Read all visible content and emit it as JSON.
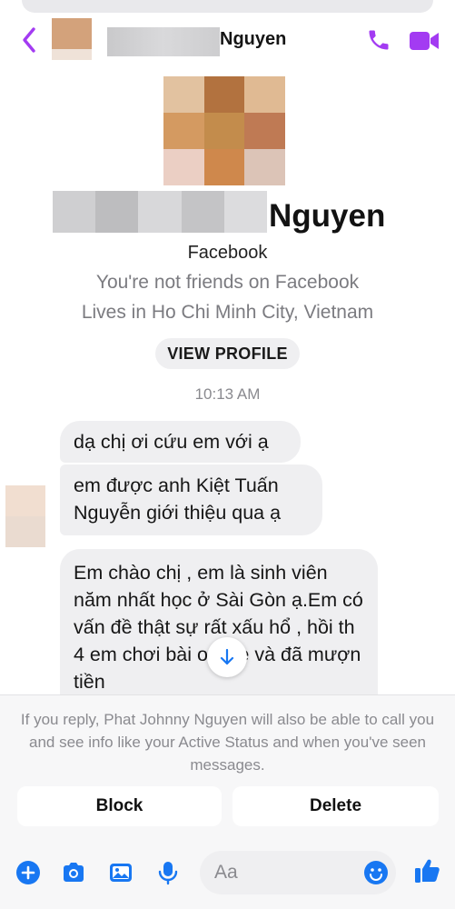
{
  "header": {
    "name_suffix": "Nguyen"
  },
  "profile": {
    "name_suffix": "Nguyen",
    "source": "Facebook",
    "friend_status": "You're not friends on Facebook",
    "lives": "Lives in Ho Chi Minh City, Vietnam",
    "view_profile_label": "VIEW PROFILE"
  },
  "thread": {
    "timestamp": "10:13 AM",
    "messages": [
      "dạ chị ơi cứu em với ạ",
      "em được anh Kiệt Tuấn Nguyễn giới thiệu qua ạ",
      "Em chào chị , em là sinh viên năm nhất học ở Sài Gòn ạ.Em có vấn đề thật sự rất xấu hổ , hồi th   4 em chơi bài online và đã mượn tiền"
    ]
  },
  "request_notice": {
    "text": "If you reply, Phat Johnny Nguyen will also be able to call you and see info like your Active Status and when you've seen messages.",
    "block_label": "Block",
    "delete_label": "Delete"
  },
  "composer": {
    "placeholder": "Aa"
  },
  "colors": {
    "accent": "#a33bf2",
    "composer_blue": "#1877f2",
    "bubble_bg": "#efeff1"
  },
  "icons": [
    "back-chevron-icon",
    "phone-icon",
    "video-camera-icon",
    "arrow-down-icon",
    "plus-circle-icon",
    "camera-icon",
    "image-icon",
    "microphone-icon",
    "emoji-icon",
    "thumbs-up-icon"
  ]
}
